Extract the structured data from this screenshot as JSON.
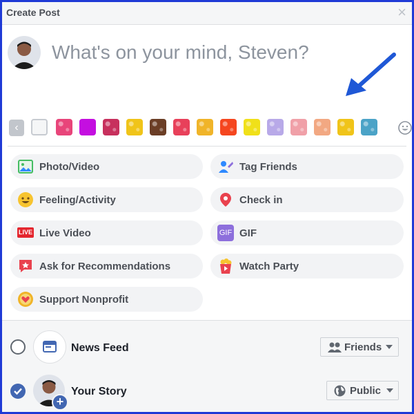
{
  "dialog": {
    "title": "Create Post",
    "close_glyph": "×"
  },
  "composer": {
    "placeholder": "What's on your mind, Steven?"
  },
  "swatches": {
    "back_glyph": "‹",
    "colors": [
      "#f5f6f7",
      "#e8457a",
      "#c40fe0",
      "#c7305d",
      "#f0c419",
      "#6b3e26",
      "#e8405a",
      "#f0b429",
      "#f5461f",
      "#f0e019",
      "#b8a9e8",
      "#f0a0a8",
      "#f2a882",
      "#f0c419",
      "#4ba3c7"
    ],
    "accent_arrow": "#1f58d6"
  },
  "actions": [
    {
      "label": "Photo/Video"
    },
    {
      "label": "Tag Friends"
    },
    {
      "label": "Feeling/Activity"
    },
    {
      "label": "Check in"
    },
    {
      "label": "Live Video",
      "badge": "LIVE"
    },
    {
      "label": "GIF",
      "badge": "GIF"
    },
    {
      "label": "Ask for Recommendations"
    },
    {
      "label": "Watch Party"
    },
    {
      "label": "Support Nonprofit"
    }
  ],
  "destinations": {
    "news_feed": {
      "label": "News Feed",
      "audience": "Friends",
      "selected": false
    },
    "your_story": {
      "label": "Your Story",
      "audience": "Public",
      "selected": true
    }
  }
}
